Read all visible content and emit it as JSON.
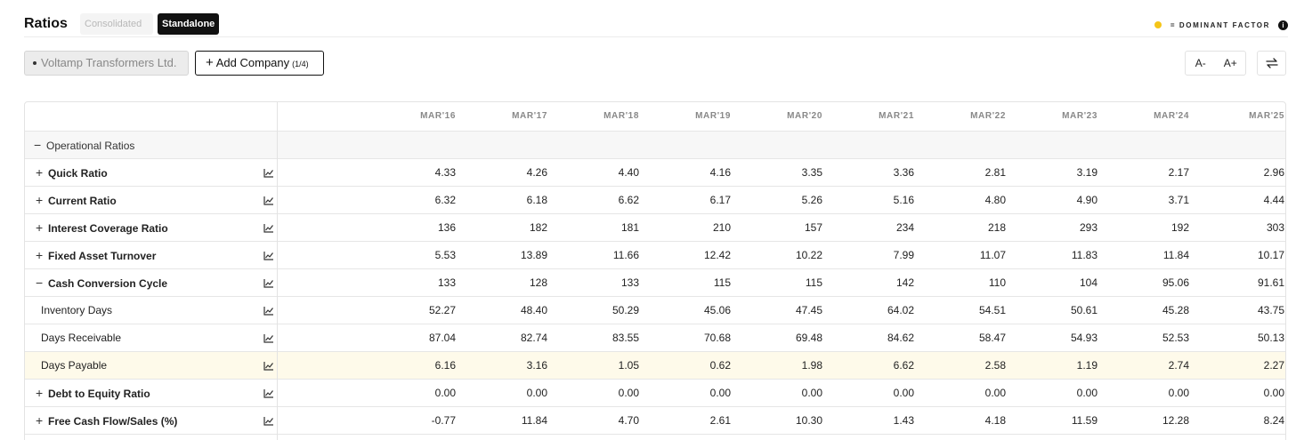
{
  "title": "Ratios",
  "toggle": {
    "consolidated": "Consolidated",
    "standalone": "Standalone",
    "active": "Standalone"
  },
  "dominant": {
    "label": "= DOMINANT FACTOR",
    "dot_color": "#f5c518",
    "info_glyph": "i"
  },
  "company_chip": "Voltamp Transformers Ltd.",
  "add_company": {
    "label": "Add Company",
    "count": "(1/4)"
  },
  "font_controls": {
    "decrease": "A-",
    "increase": "A+"
  },
  "columns": [
    "MAR'16",
    "MAR'17",
    "MAR'18",
    "MAR'19",
    "MAR'20",
    "MAR'21",
    "MAR'22",
    "MAR'23",
    "MAR'24",
    "MAR'25"
  ],
  "group": {
    "label": "Operational Ratios",
    "expander": "−"
  },
  "rows": [
    {
      "label": "Quick Ratio",
      "expander": "+",
      "values": [
        "4.33",
        "4.26",
        "4.40",
        "4.16",
        "3.35",
        "3.36",
        "2.81",
        "3.19",
        "2.17",
        "2.96"
      ]
    },
    {
      "label": "Current Ratio",
      "expander": "+",
      "values": [
        "6.32",
        "6.18",
        "6.62",
        "6.17",
        "5.26",
        "5.16",
        "4.80",
        "4.90",
        "3.71",
        "4.44"
      ]
    },
    {
      "label": "Interest Coverage Ratio",
      "expander": "+",
      "values": [
        "136",
        "182",
        "181",
        "210",
        "157",
        "234",
        "218",
        "293",
        "192",
        "303"
      ]
    },
    {
      "label": "Fixed Asset Turnover",
      "expander": "+",
      "values": [
        "5.53",
        "13.89",
        "11.66",
        "12.42",
        "10.22",
        "7.99",
        "11.07",
        "11.83",
        "11.84",
        "10.17"
      ]
    },
    {
      "label": "Cash Conversion Cycle",
      "expander": "−",
      "values": [
        "133",
        "128",
        "133",
        "115",
        "115",
        "142",
        "110",
        "104",
        "95.06",
        "91.61"
      ]
    },
    {
      "label": "Inventory Days",
      "expander": "",
      "values": [
        "52.27",
        "48.40",
        "50.29",
        "45.06",
        "47.45",
        "64.02",
        "54.51",
        "50.61",
        "45.28",
        "43.75"
      ]
    },
    {
      "label": "Days Receivable",
      "expander": "",
      "values": [
        "87.04",
        "82.74",
        "83.55",
        "70.68",
        "69.48",
        "84.62",
        "58.47",
        "54.93",
        "52.53",
        "50.13"
      ]
    },
    {
      "label": "Days Payable",
      "expander": "",
      "highlight": true,
      "values": [
        "6.16",
        "3.16",
        "1.05",
        "0.62",
        "1.98",
        "6.62",
        "2.58",
        "1.19",
        "2.74",
        "2.27"
      ]
    },
    {
      "label": "Debt to Equity Ratio",
      "expander": "+",
      "values": [
        "0.00",
        "0.00",
        "0.00",
        "0.00",
        "0.00",
        "0.00",
        "0.00",
        "0.00",
        "0.00",
        "0.00"
      ]
    },
    {
      "label": "Free Cash Flow/Sales (%)",
      "expander": "+",
      "values": [
        "-0.77",
        "11.84",
        "4.70",
        "2.61",
        "10.30",
        "1.43",
        "4.18",
        "11.59",
        "12.28",
        "8.24"
      ]
    }
  ],
  "colors": {
    "highlight_row": "#fefaea",
    "active_toggle": "#111111",
    "group_row": "#f7f7f7"
  }
}
